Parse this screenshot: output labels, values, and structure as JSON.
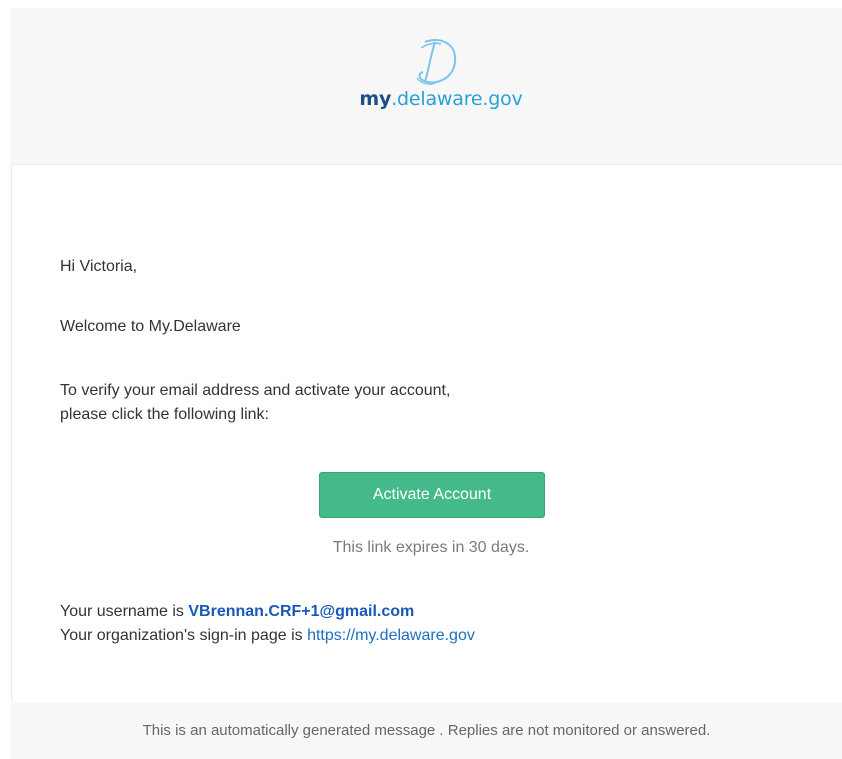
{
  "header": {
    "logo_my": "my",
    "logo_rest": ".delaware.gov",
    "logo_mark_icon": "delaware-d-script-icon",
    "brand_colors": {
      "my": "#1b4f86",
      "domain": "#2a9fd6"
    }
  },
  "body": {
    "greeting": "Hi Victoria,",
    "welcome": "Welcome to My.Delaware",
    "verify_line1": "To verify your email address and activate your account,",
    "verify_line2": "please click the following link:",
    "activate_button": "Activate Account",
    "button_color": "#44b98a",
    "expires": "This link expires in 30 days.",
    "username_prefix": "Your username is ",
    "username": "VBrennan.CRF+1@gmail.com",
    "signin_prefix": "Your organization's sign-in page is ",
    "signin_link": "https://my.delaware.gov"
  },
  "footer": {
    "text": "This is an automatically generated message . Replies are not monitored or answered."
  }
}
